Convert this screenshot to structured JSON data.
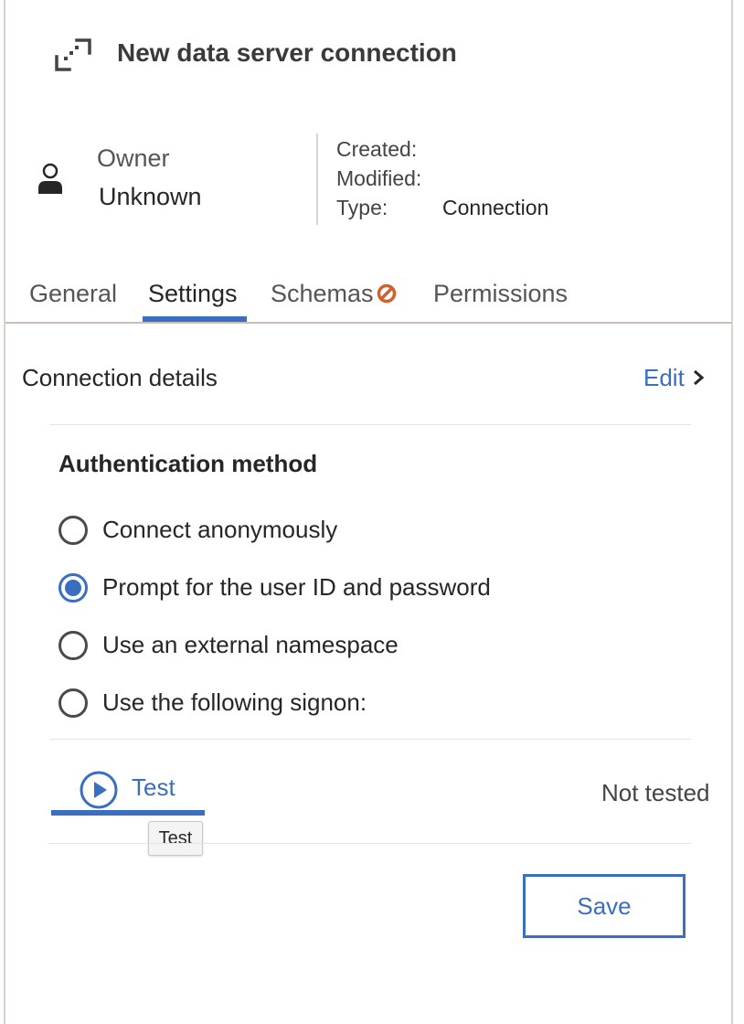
{
  "header": {
    "title": "New data server connection",
    "icon": "connection-icon"
  },
  "owner": {
    "label": "Owner",
    "value": "Unknown",
    "icon": "user-icon"
  },
  "meta": {
    "created_label": "Created:",
    "created_value": "",
    "modified_label": "Modified:",
    "modified_value": "",
    "type_label": "Type:",
    "type_value": "Connection"
  },
  "tabs": [
    {
      "label": "General",
      "active": false
    },
    {
      "label": "Settings",
      "active": true
    },
    {
      "label": "Schemas",
      "active": false,
      "icon": "blocked-icon"
    },
    {
      "label": "Permissions",
      "active": false
    }
  ],
  "connection": {
    "title": "Connection details",
    "edit_label": "Edit"
  },
  "auth": {
    "title": "Authentication method",
    "options": [
      {
        "label": "Connect anonymously",
        "selected": false
      },
      {
        "label": "Prompt for the user ID and password",
        "selected": true
      },
      {
        "label": "Use an external namespace",
        "selected": false
      },
      {
        "label": "Use the following signon:",
        "selected": false
      }
    ]
  },
  "test": {
    "label": "Test",
    "tooltip": "Test",
    "status": "Not tested"
  },
  "save_label": "Save",
  "colors": {
    "accent": "#3a6fbf",
    "warning": "#d2602a",
    "border": "#d8d2cc"
  }
}
